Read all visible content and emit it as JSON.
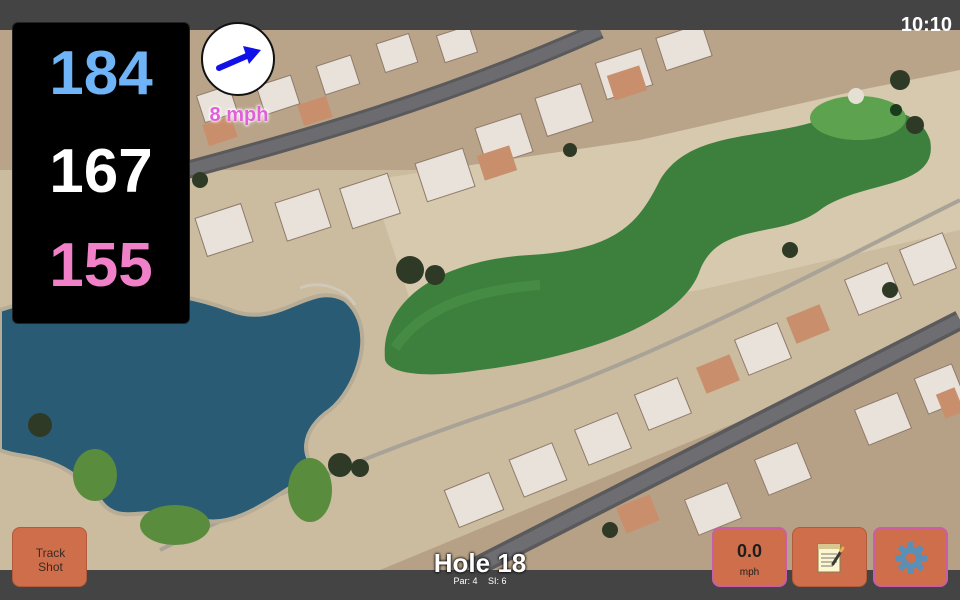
{
  "status_bar": {
    "time": "10:10"
  },
  "distances": {
    "back": "184",
    "middle": "167",
    "front": "155"
  },
  "colors": {
    "back": "#6eb4f6",
    "middle": "#ffffff",
    "front": "#f080c8",
    "wind_arrow": "#1010e8",
    "wind_text": "#e060d8",
    "button": "#cf6e4a",
    "button_highlight": "#c95ea6"
  },
  "wind": {
    "speed_label": "8 mph",
    "direction": "east-northeast",
    "icon": "arrow-icon"
  },
  "hole": {
    "title": "Hole 18",
    "par": "Par: 4",
    "si": "SI: 6"
  },
  "buttons": {
    "track_shot_line1": "Track",
    "track_shot_line2": "Shot",
    "wind_value": "0.0",
    "wind_unit": "mph",
    "notes_icon": "notepad-icon",
    "settings_icon": "gear-icon"
  },
  "map": {
    "type": "satellite",
    "features": [
      "fairway",
      "green",
      "lake",
      "houses",
      "roads"
    ]
  }
}
